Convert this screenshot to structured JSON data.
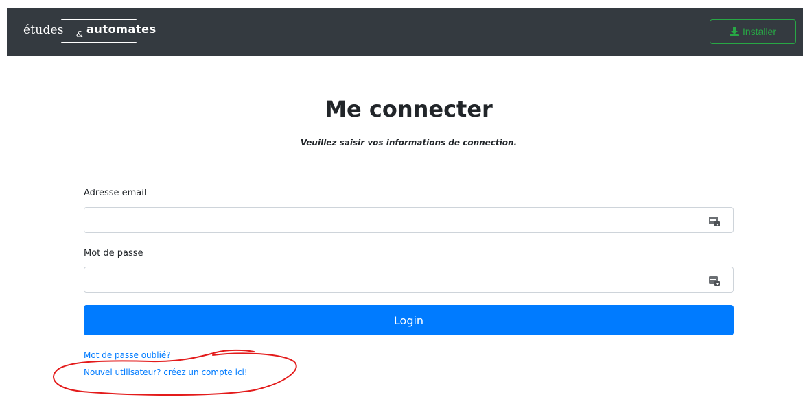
{
  "navbar": {
    "brand": {
      "part1": "études",
      "amp": "&",
      "part2": "automates"
    },
    "install_label": "Installer",
    "install_icon": "download-icon"
  },
  "main": {
    "title": "Me connecter",
    "subtitle": "Veuillez saisir vos informations de connection.",
    "email": {
      "label": "Adresse email",
      "value": "",
      "icon": "password-manager-icon"
    },
    "password": {
      "label": "Mot de passe",
      "value": "",
      "icon": "password-manager-icon"
    },
    "login_label": "Login",
    "forgot_link": "Mot de passe oublié?",
    "signup_link": "Nouvel utilisateur? créez un compte ici!"
  },
  "colors": {
    "navbar_bg": "#343a40",
    "accent": "#007bff",
    "success": "#28a745",
    "annotation": "#e31b1b"
  }
}
